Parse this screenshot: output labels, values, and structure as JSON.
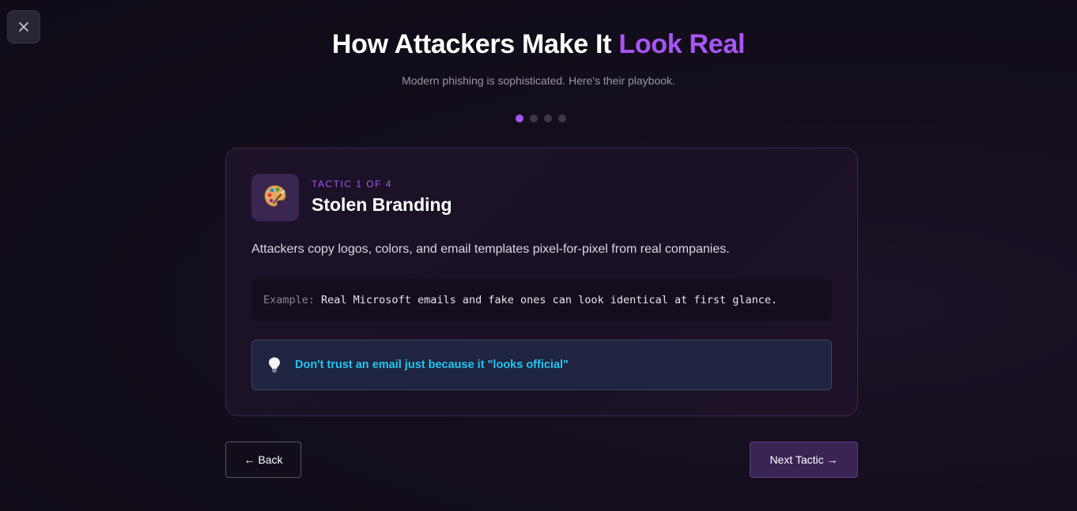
{
  "header": {
    "title_main": "How Attackers Make It",
    "title_accent": "Look Real",
    "subtitle": "Modern phishing is sophisticated. Here's their playbook.",
    "close_icon": "close-icon"
  },
  "progress": {
    "current": 1,
    "total": 4
  },
  "card": {
    "icon": "palette-icon",
    "tactic_label": "TACTIC 1 OF 4",
    "tactic_name": "Stolen Branding",
    "description": "Attackers copy logos, colors, and email templates pixel-for-pixel from real companies.",
    "example_label": "Example:",
    "example_text": "Real Microsoft emails and fake ones can look identical at first glance.",
    "tip_icon": "lightbulb-icon",
    "tip_text": "Don't trust an email just because it \"looks official\""
  },
  "nav": {
    "back_label": "← Back",
    "next_label": "Next Tactic →"
  },
  "colors": {
    "accent": "#a855f7",
    "tip_text": "#22c5ee",
    "background": "#140e1c"
  }
}
